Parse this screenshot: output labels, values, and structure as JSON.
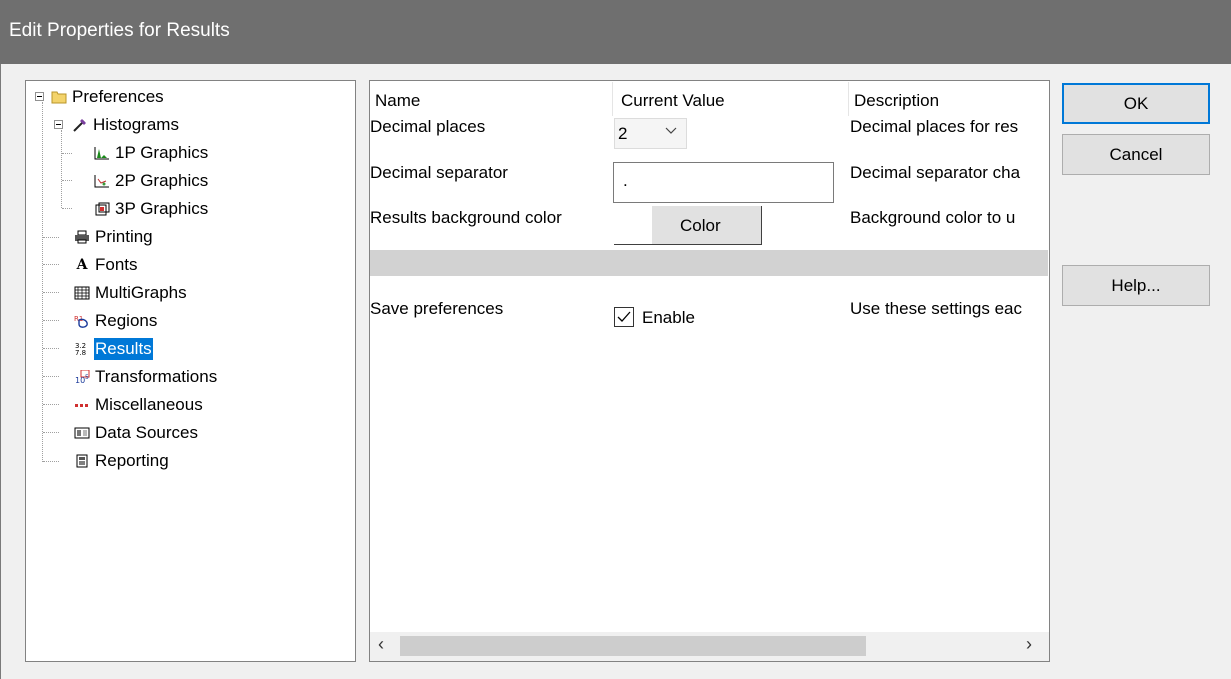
{
  "window": {
    "title": "Edit Properties for Results"
  },
  "tree": {
    "items": [
      {
        "label": "Preferences",
        "icon": "folder-icon"
      },
      {
        "label": "Histograms",
        "icon": "histogram-tool-icon"
      },
      {
        "label": "1P Graphics",
        "icon": "1p-graphics-icon"
      },
      {
        "label": "2P Graphics",
        "icon": "2p-graphics-icon"
      },
      {
        "label": "3P Graphics",
        "icon": "3p-graphics-icon"
      },
      {
        "label": "Printing",
        "icon": "printer-icon"
      },
      {
        "label": "Fonts",
        "icon": "font-icon"
      },
      {
        "label": "MultiGraphs",
        "icon": "multigraph-icon"
      },
      {
        "label": "Regions",
        "icon": "regions-icon"
      },
      {
        "label": "Results",
        "icon": "results-icon",
        "selected": true
      },
      {
        "label": "Transformations",
        "icon": "transformations-icon"
      },
      {
        "label": "Miscellaneous",
        "icon": "miscellaneous-icon"
      },
      {
        "label": "Data Sources",
        "icon": "data-sources-icon"
      },
      {
        "label": "Reporting",
        "icon": "reporting-icon"
      }
    ],
    "font_glyph": "A"
  },
  "grid": {
    "headers": {
      "name": "Name",
      "value": "Current Value",
      "description": "Description"
    },
    "rows": {
      "decimal_places": {
        "name": "Decimal places",
        "value": "2",
        "description": "Decimal places for res"
      },
      "decimal_separator": {
        "name": "Decimal separator",
        "value": ".",
        "description": "Decimal separator cha"
      },
      "background_color": {
        "name": "Results background color",
        "button": "Color",
        "description": "Background color to u",
        "swatch_color": "#ffffff"
      },
      "save_preferences": {
        "name": "Save preferences",
        "checkbox_label": "Enable",
        "checked": true,
        "description": "Use these settings eac"
      }
    },
    "scroll_left": "‹",
    "scroll_right": "›"
  },
  "buttons": {
    "ok": "OK",
    "cancel": "Cancel",
    "help": "Help..."
  },
  "colors": {
    "titlebar": "#6f6f6f",
    "selection": "#0078d7",
    "default_button_border": "#0078d7"
  }
}
